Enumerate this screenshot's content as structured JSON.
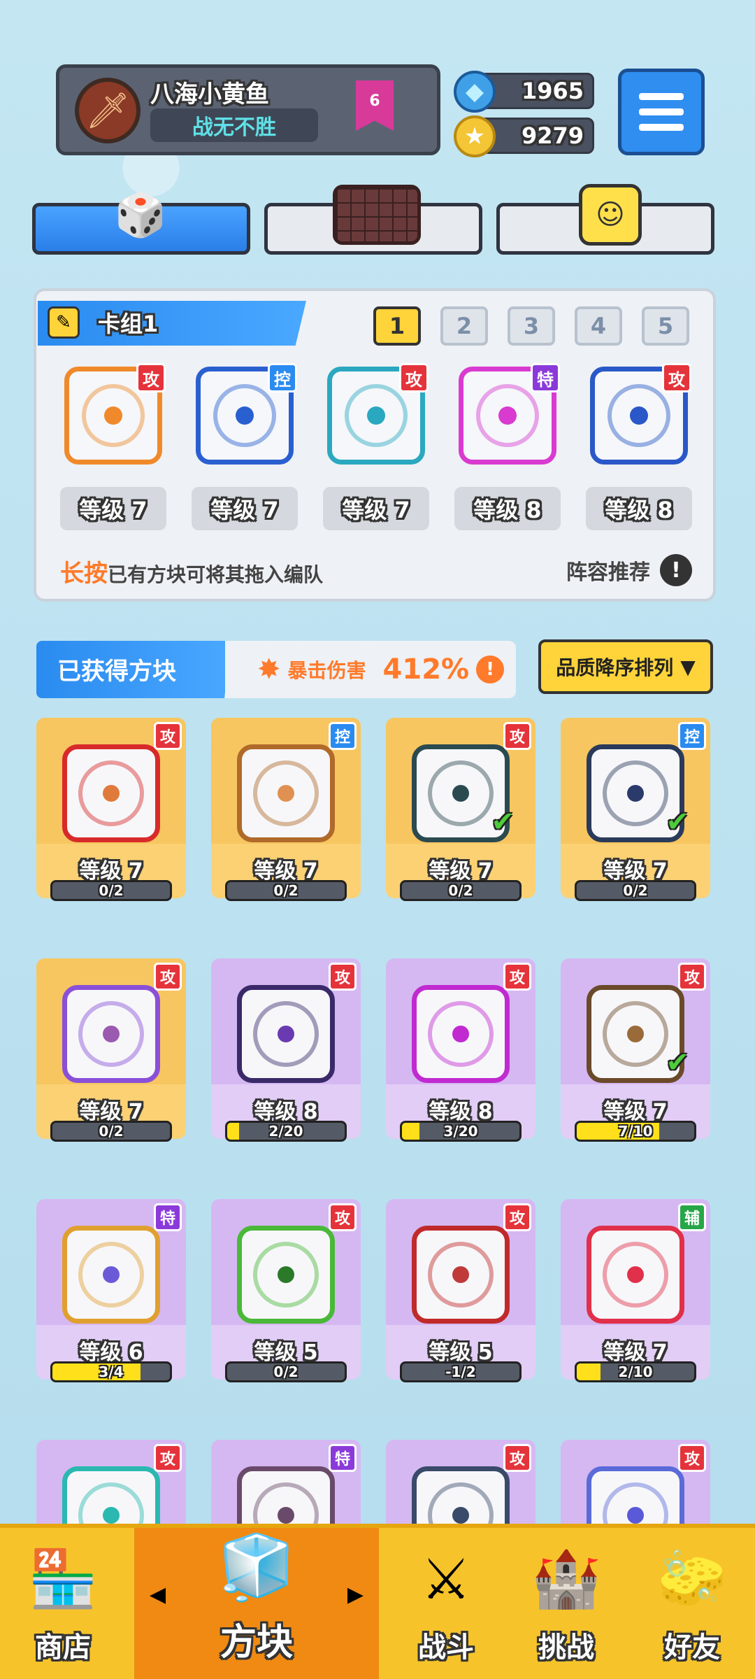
{
  "player": {
    "name": "八海小黄鱼",
    "title": "战无不胜",
    "rank": "6"
  },
  "currency": {
    "gems": "1965",
    "coins": "9279"
  },
  "top_tabs": [
    {
      "icon": "dice-icon"
    },
    {
      "icon": "board-icon"
    },
    {
      "icon": "smile-cube-icon"
    }
  ],
  "deck": {
    "name": "卡组1",
    "slots": [
      "1",
      "2",
      "3",
      "4",
      "5"
    ],
    "selected": "1",
    "cards": [
      {
        "level": "等级 7",
        "tag": "攻",
        "color": "#f0892a"
      },
      {
        "level": "等级 7",
        "tag": "控",
        "color": "#2a5fd0"
      },
      {
        "level": "等级 7",
        "tag": "攻",
        "color": "#2aa8c0"
      },
      {
        "level": "等级 8",
        "tag": "特",
        "color": "#d93ad0"
      },
      {
        "level": "等级 8",
        "tag": "攻",
        "color": "#2a58c8"
      }
    ],
    "hint_strong": "长按",
    "hint_rest": "已有方块可将其拖入编队",
    "recommend": "阵容推荐",
    "recommend_icon": "!"
  },
  "owned": {
    "title": "已获得方块",
    "crit_label": "暴击伤害",
    "crit_value": "412%",
    "crit_icon": "!",
    "sort_label": "品质降序排列",
    "sort_arrow": "▼",
    "cards": [
      {
        "level": "等级 7",
        "progress": "0/2",
        "tag": "攻",
        "color": "#d82a2a",
        "dot": "#e07a3a",
        "style": "gold",
        "fill": 0,
        "check": false
      },
      {
        "level": "等级 7",
        "progress": "0/2",
        "tag": "控",
        "color": "#b06a2a",
        "dot": "#e09050",
        "style": "gold",
        "fill": 0,
        "check": false
      },
      {
        "level": "等级 7",
        "progress": "0/2",
        "tag": "攻",
        "color": "#2a4a50",
        "dot": "#2a4a50",
        "style": "gold",
        "fill": 0,
        "check": true
      },
      {
        "level": "等级 7",
        "progress": "0/2",
        "tag": "控",
        "color": "#2a3a5a",
        "dot": "#2a3a6a",
        "style": "gold",
        "fill": 0,
        "check": true
      },
      {
        "level": "等级 7",
        "progress": "0/2",
        "tag": "攻",
        "color": "#8a50d8",
        "dot": "#9a5ab0",
        "style": "gold",
        "fill": 0,
        "check": false
      },
      {
        "level": "等级 8",
        "progress": "2/20",
        "tag": "攻",
        "color": "#3a2a6a",
        "dot": "#6a3ab0",
        "style": "purple",
        "fill": 0.1,
        "check": false
      },
      {
        "level": "等级 8",
        "progress": "3/20",
        "tag": "攻",
        "color": "#c02ad0",
        "dot": "#c02ad0",
        "style": "purple",
        "fill": 0.15,
        "check": false
      },
      {
        "level": "等级 7",
        "progress": "7/10",
        "tag": "攻",
        "color": "#6a4a2a",
        "dot": "#9a6a3a",
        "style": "purple",
        "fill": 0.7,
        "check": true
      },
      {
        "level": "等级 6",
        "progress": "3/4",
        "tag": "特",
        "color": "#e0a030",
        "dot": "#6a5ad8",
        "style": "purple",
        "fill": 0.75,
        "check": false
      },
      {
        "level": "等级 5",
        "progress": "0/2",
        "tag": "攻",
        "color": "#4ab838",
        "dot": "#2a7a2a",
        "style": "purple",
        "fill": 0,
        "check": false
      },
      {
        "level": "等级 5",
        "progress": "-1/2",
        "tag": "攻",
        "color": "#c02a2a",
        "dot": "#c03a3a",
        "style": "purple",
        "fill": 0,
        "check": false
      },
      {
        "level": "等级 7",
        "progress": "2/10",
        "tag": "辅",
        "color": "#e0304a",
        "dot": "#e0304a",
        "style": "purple",
        "fill": 0.2,
        "check": false
      },
      {
        "level": "",
        "progress": "",
        "tag": "攻",
        "color": "#2ab8b0",
        "dot": "#2ab8b0",
        "style": "purple",
        "fill": 0,
        "check": false
      },
      {
        "level": "",
        "progress": "",
        "tag": "特",
        "color": "#6a4a6a",
        "dot": "#6a4a6a",
        "style": "purple",
        "fill": 0,
        "check": false
      },
      {
        "level": "",
        "progress": "",
        "tag": "攻",
        "color": "#3a4a6a",
        "dot": "#3a4a6a",
        "style": "purple",
        "fill": 0,
        "check": false
      },
      {
        "level": "",
        "progress": "",
        "tag": "攻",
        "color": "#5a6ad8",
        "dot": "#5a5ad8",
        "style": "purple",
        "fill": 0,
        "check": false
      }
    ]
  },
  "nav": {
    "shop": "商店",
    "cube": "方块",
    "battle": "战斗",
    "challenge": "挑战",
    "friends": "好友",
    "left_arrow": "◀",
    "right_arrow": "▶"
  }
}
